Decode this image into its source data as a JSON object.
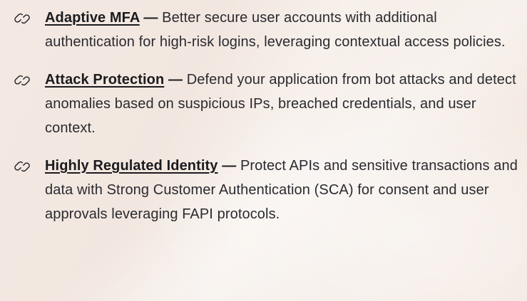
{
  "features": [
    {
      "icon": "link-icon",
      "title": "Adaptive MFA",
      "separator": " — ",
      "description": "Better secure user accounts with additional authentication for high-risk logins, leveraging contextual access policies."
    },
    {
      "icon": "link-icon",
      "title": "Attack Protection",
      "separator": " — ",
      "description": "Defend your application from bot attacks and detect anomalies based on suspicious IPs, breached credentials, and user context."
    },
    {
      "icon": "link-icon",
      "title": "Highly Regulated Identity",
      "separator": " — ",
      "description": "Protect APIs and sensitive transactions and data with Strong Customer Authentication (SCA) for consent and user approvals leveraging FAPI protocols."
    }
  ]
}
